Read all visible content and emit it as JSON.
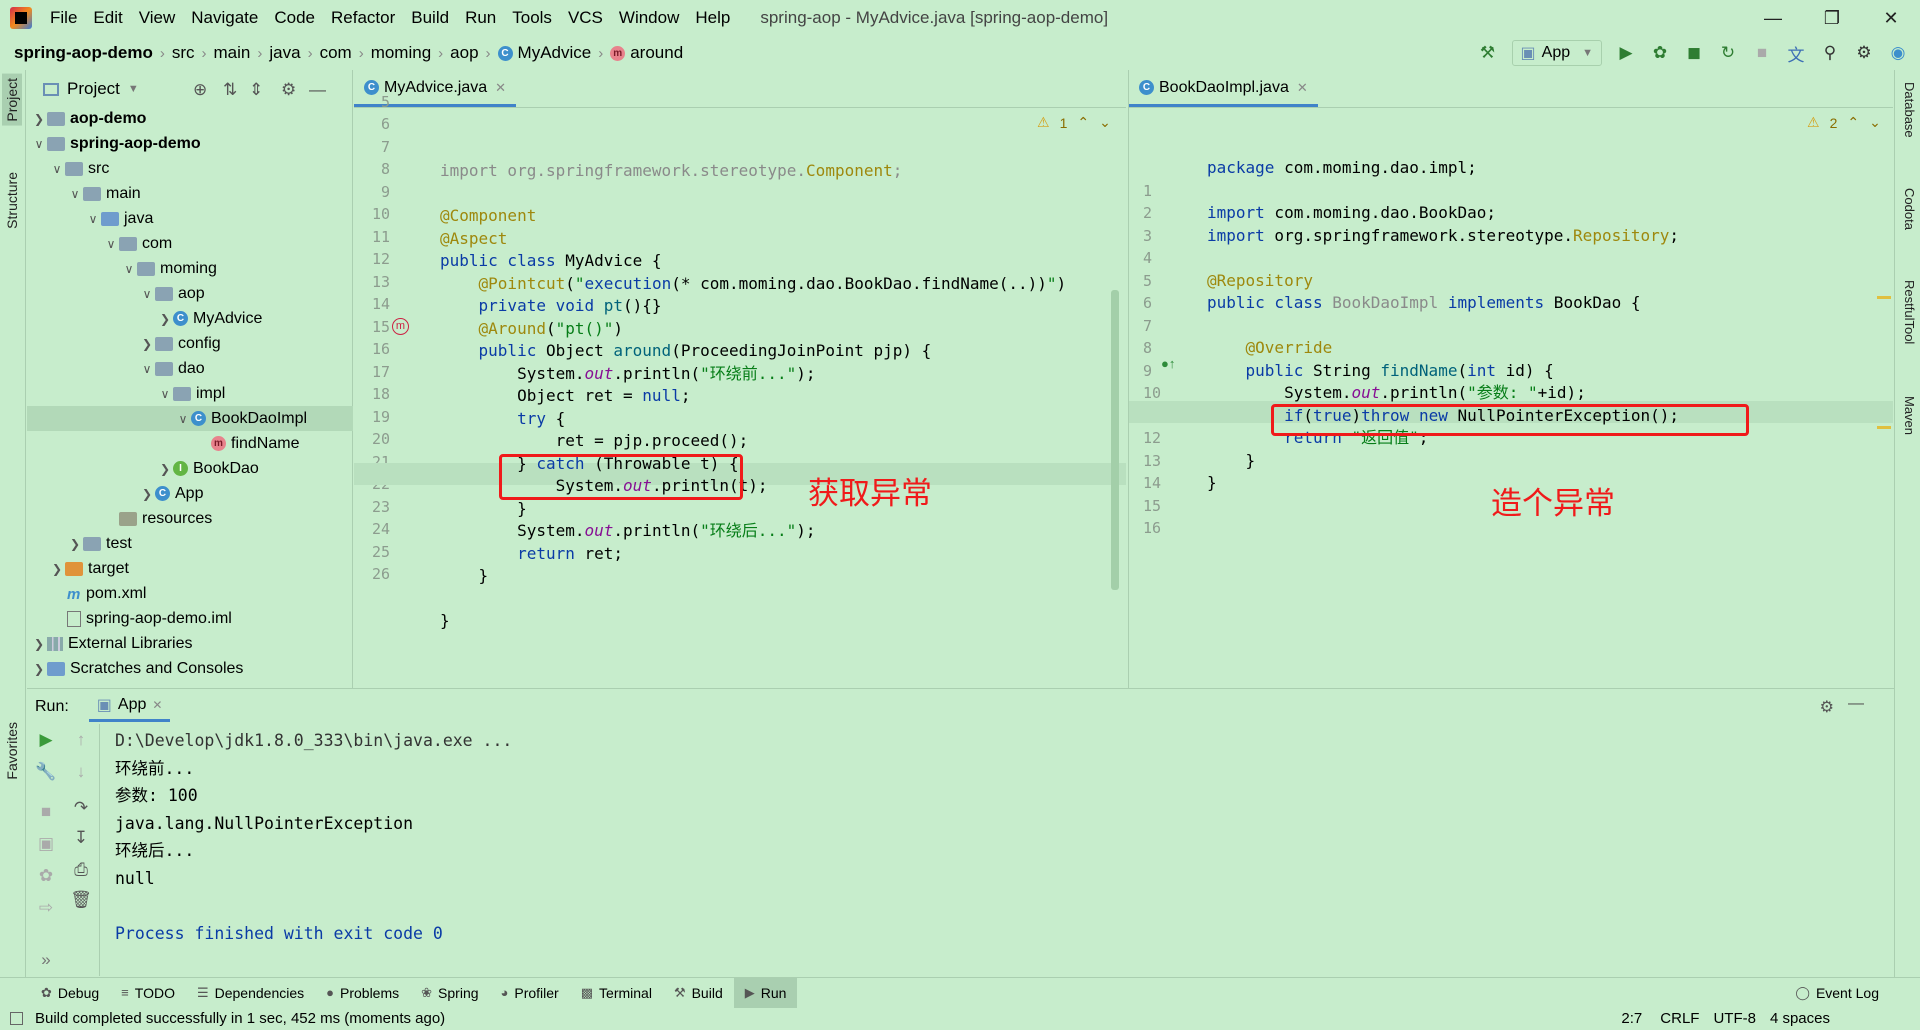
{
  "menubar": {
    "items": [
      "File",
      "Edit",
      "View",
      "Navigate",
      "Code",
      "Refactor",
      "Build",
      "Run",
      "Tools",
      "VCS",
      "Window",
      "Help"
    ],
    "window_title": "spring-aop - MyAdvice.java [spring-aop-demo]"
  },
  "navbar": {
    "crumbs": [
      "spring-aop-demo",
      "src",
      "main",
      "java",
      "com",
      "moming",
      "aop",
      "MyAdvice",
      "around"
    ],
    "run_config": "App"
  },
  "left_stripe": {
    "project": "Project",
    "structure": "Structure",
    "favorites": "Favorites"
  },
  "right_stripe": {
    "database": "Database",
    "codota": "Codota",
    "restfultool": "RestfulTool",
    "maven": "Maven"
  },
  "project_panel": {
    "title": "Project",
    "tree": [
      {
        "label": "aop-demo",
        "bold": true
      },
      {
        "label": "spring-aop-demo",
        "bold": true
      },
      {
        "label": "src"
      },
      {
        "label": "main"
      },
      {
        "label": "java"
      },
      {
        "label": "com"
      },
      {
        "label": "moming"
      },
      {
        "label": "aop"
      },
      {
        "label": "MyAdvice"
      },
      {
        "label": "config"
      },
      {
        "label": "dao"
      },
      {
        "label": "impl"
      },
      {
        "label": "BookDaoImpl"
      },
      {
        "label": "findName"
      },
      {
        "label": "BookDao"
      },
      {
        "label": "App"
      },
      {
        "label": "resources"
      },
      {
        "label": "test"
      },
      {
        "label": "target"
      },
      {
        "label": "pom.xml"
      },
      {
        "label": "spring-aop-demo.iml"
      },
      {
        "label": "External Libraries"
      },
      {
        "label": "Scratches and Consoles"
      }
    ]
  },
  "left_editor": {
    "tab": "MyAdvice.java",
    "warning_count": "1",
    "line_numbers": [
      "5",
      "6",
      "7",
      "8",
      "9",
      "10",
      "11",
      "12",
      "13",
      "14",
      "15",
      "16",
      "17",
      "18",
      "19",
      "20",
      "21",
      "22",
      "23",
      "24",
      "25",
      "26"
    ],
    "annotation": "获取异常"
  },
  "right_editor": {
    "tab": "BookDaoImpl.java",
    "warning_count": "2",
    "line_numbers": [
      "1",
      "2",
      "3",
      "4",
      "5",
      "6",
      "7",
      "8",
      "9",
      "10",
      "11",
      "12",
      "13",
      "14",
      "15",
      "16"
    ],
    "annotation": "造个异常"
  },
  "run_panel": {
    "label": "Run:",
    "tab": "App",
    "console": [
      "D:\\Develop\\jdk1.8.0_333\\bin\\java.exe ...",
      "环绕前...",
      "参数: 100",
      "java.lang.NullPointerException",
      "环绕后...",
      "null",
      "",
      "Process finished with exit code 0"
    ]
  },
  "bottom_tabs": [
    "Debug",
    "TODO",
    "Dependencies",
    "Problems",
    "Spring",
    "Profiler",
    "Terminal",
    "Build",
    "Run"
  ],
  "event_log": "Event Log",
  "statusbar": {
    "message": "Build completed successfully in 1 sec, 452 ms (moments ago)",
    "position": "2:7",
    "line_sep": "CRLF",
    "encoding": "UTF-8",
    "indent": "4 spaces"
  },
  "colors": {
    "background": "#c7edcc",
    "keyword": "#0a3ba6",
    "annotation": "#9e880d",
    "string": "#067d17",
    "highlight_box": "#f01a1a"
  }
}
